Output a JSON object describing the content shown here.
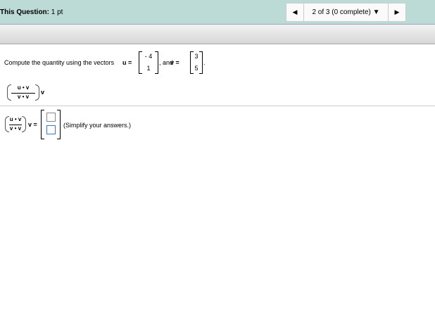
{
  "header": {
    "question_label": "This Question:",
    "question_points": "1 pt",
    "nav_status": "2 of 3 (0 complete)"
  },
  "problem": {
    "prompt": "Compute the quantity using the vectors ",
    "u_label": "u =",
    "u": [
      "- 4",
      "1"
    ],
    "and_label": ", and ",
    "v_label": "v =",
    "v": [
      "3",
      "5"
    ],
    "period": "."
  },
  "expression": {
    "num": "u • v",
    "den": "v • v",
    "mult": "v"
  },
  "answer": {
    "num": "u • v",
    "den": "v • v",
    "eq": "v =",
    "values": [
      "",
      ""
    ],
    "hint": "(Simplify your answers.)"
  },
  "colors": {
    "header": "#bcdad6",
    "active_input": "#3a78c9"
  }
}
